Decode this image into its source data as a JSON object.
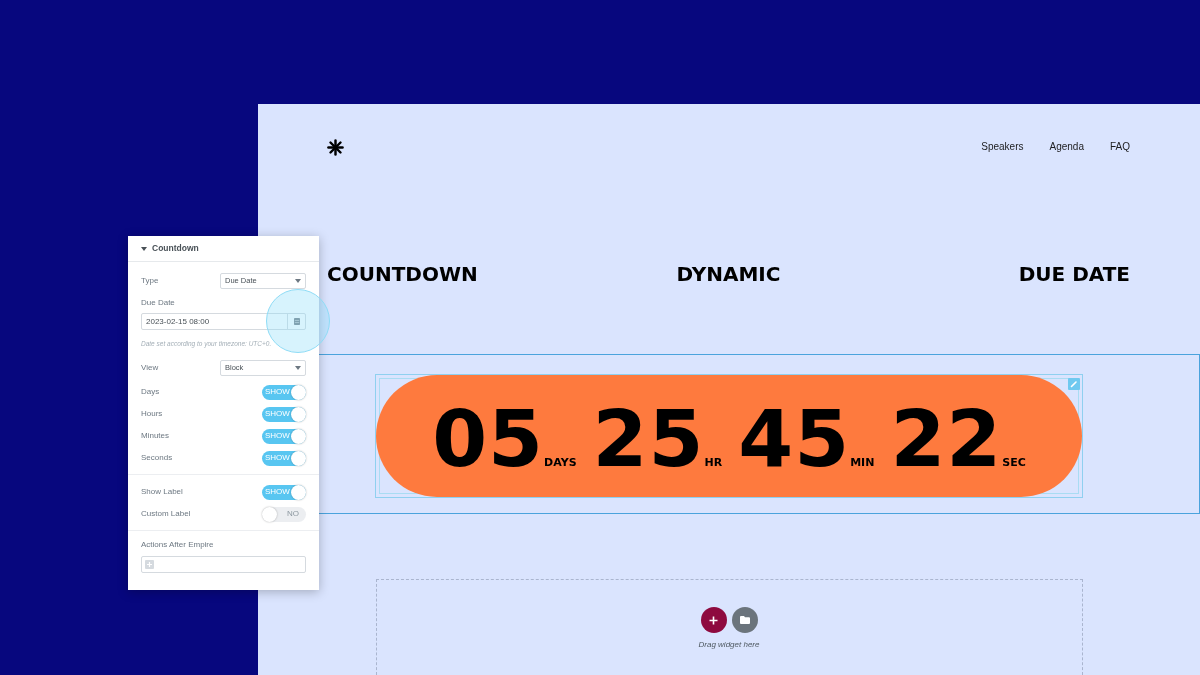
{
  "site": {
    "nav": [
      {
        "label": "Speakers"
      },
      {
        "label": "Agenda"
      },
      {
        "label": "FAQ"
      }
    ],
    "headings": [
      "COUNTDOWN",
      "DYNAMIC",
      "DUE DATE"
    ],
    "countdown": {
      "selected": true,
      "units": [
        {
          "value": "05",
          "unit": "DAYS"
        },
        {
          "value": "25",
          "unit": "HR"
        },
        {
          "value": "45",
          "unit": "MIN"
        },
        {
          "value": "22",
          "unit": "SEC"
        }
      ]
    },
    "drop_zone": {
      "text": "Drag widget here"
    }
  },
  "panel": {
    "title": "Countdown",
    "expanded": true,
    "sections": [
      {
        "rows": [
          {
            "kind": "select",
            "label": "Type",
            "value": "Due Date"
          },
          {
            "kind": "date",
            "label": "Due Date",
            "value": "2023-02-15 08:00",
            "hint": "Date set according to your timezone: UTC+0."
          },
          {
            "kind": "select",
            "label": "View",
            "value": "Block"
          },
          {
            "kind": "toggle",
            "label": "Days",
            "on": true,
            "state_text": "SHOW"
          },
          {
            "kind": "toggle",
            "label": "Hours",
            "on": true,
            "state_text": "SHOW"
          },
          {
            "kind": "toggle",
            "label": "Minutes",
            "on": true,
            "state_text": "SHOW"
          },
          {
            "kind": "toggle",
            "label": "Seconds",
            "on": true,
            "state_text": "SHOW"
          }
        ]
      },
      {
        "rows": [
          {
            "kind": "toggle",
            "label": "Show Label",
            "on": true,
            "state_text": "SHOW"
          },
          {
            "kind": "toggle",
            "label": "Custom Label",
            "on": false,
            "state_text": "NO"
          }
        ]
      },
      {
        "rows": [
          {
            "kind": "actions",
            "label": "Actions After Empire"
          }
        ]
      }
    ]
  }
}
